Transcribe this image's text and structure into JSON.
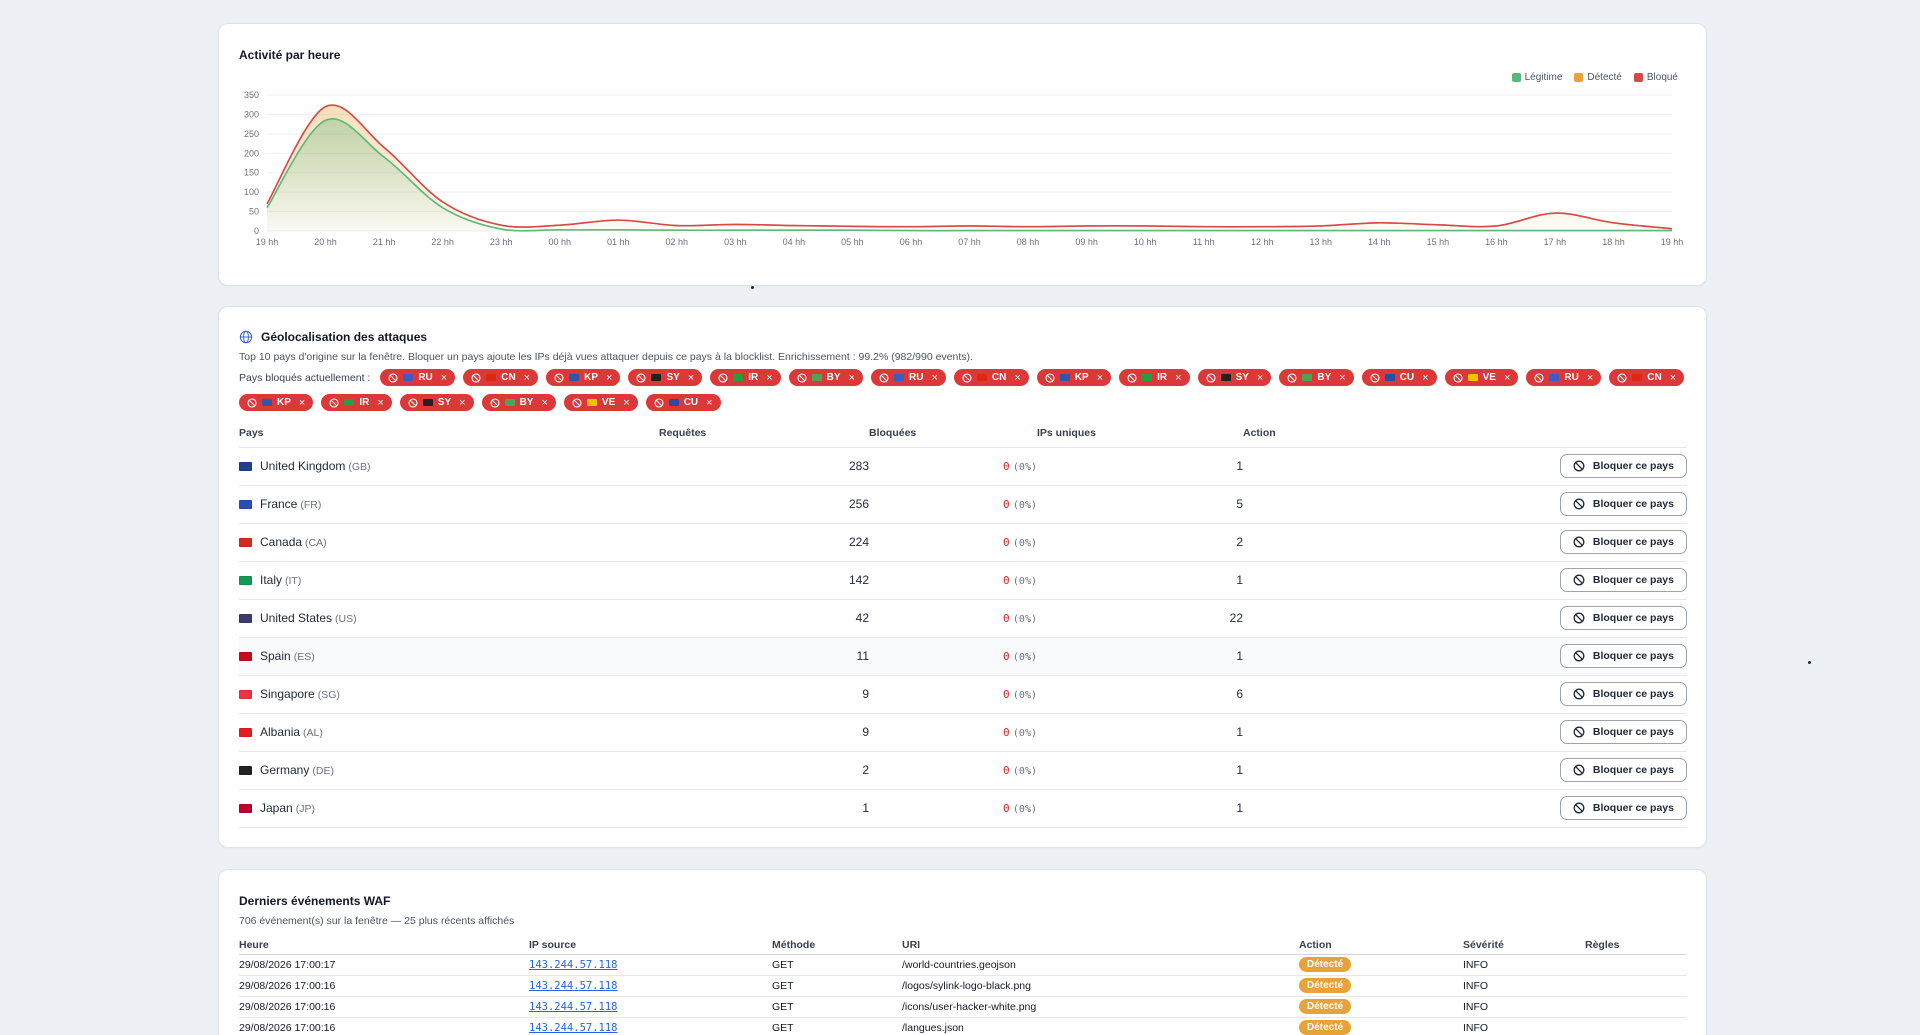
{
  "chart_card": {
    "title": "Activité par heure",
    "legend": [
      {
        "label": "Légitime",
        "color": "#5cb87a"
      },
      {
        "label": "Détecté",
        "color": "#e8a23a"
      },
      {
        "label": "Bloqué",
        "color": "#d94848"
      }
    ]
  },
  "chart_data": {
    "type": "area",
    "title": "Activité par heure",
    "categories": [
      "19 hh",
      "20 hh",
      "21 hh",
      "22 hh",
      "23 hh",
      "00 hh",
      "01 hh",
      "02 hh",
      "03 hh",
      "04 hh",
      "05 hh",
      "06 hh",
      "07 hh",
      "08 hh",
      "09 hh",
      "10 hh",
      "11 hh",
      "12 hh",
      "13 hh",
      "14 hh",
      "15 hh",
      "16 hh",
      "17 hh",
      "18 hh",
      "19 hh"
    ],
    "ylim": [
      0,
      350
    ],
    "yticks": [
      0,
      50,
      100,
      150,
      200,
      250,
      300,
      350
    ],
    "grid": true,
    "legend_position": "top-right",
    "series": [
      {
        "name": "Légitime",
        "values": [
          60,
          285,
          190,
          60,
          5,
          3,
          3,
          2,
          2,
          2,
          2,
          1,
          1,
          1,
          1,
          1,
          1,
          1,
          1,
          1,
          1,
          1,
          1,
          1,
          1
        ]
      },
      {
        "name": "Détecté",
        "values": [
          10,
          35,
          25,
          15,
          10,
          12,
          25,
          12,
          15,
          12,
          10,
          10,
          12,
          10,
          12,
          12,
          10,
          10,
          12,
          20,
          15,
          12,
          45,
          20,
          5
        ]
      },
      {
        "name": "Bloqué",
        "values": [
          0,
          0,
          0,
          0,
          0,
          0,
          0,
          0,
          0,
          0,
          0,
          0,
          0,
          0,
          0,
          0,
          0,
          0,
          0,
          0,
          0,
          0,
          0,
          0,
          0
        ]
      }
    ]
  },
  "geo": {
    "title": "Géolocalisation des attaques",
    "description": "Top 10 pays d'origine sur la fenêtre. Bloquer un pays ajoute les IPs déjà vues attaquer depuis ce pays à la blocklist. Enrichissement : 99.2% (982/990 events).",
    "blocked_label": "Pays bloqués actuellement :",
    "blocked_chips": [
      {
        "code": "RU",
        "flag": "#3b5fc0"
      },
      {
        "code": "CN",
        "flag": "#de2910"
      },
      {
        "code": "KP",
        "flag": "#3056a8"
      },
      {
        "code": "SY",
        "flag": "#222222"
      },
      {
        "code": "IR",
        "flag": "#239f40"
      },
      {
        "code": "BY",
        "flag": "#4aa657"
      },
      {
        "code": "RU",
        "flag": "#3b5fc0"
      },
      {
        "code": "CN",
        "flag": "#de2910"
      },
      {
        "code": "KP",
        "flag": "#3056a8"
      },
      {
        "code": "IR",
        "flag": "#239f40"
      },
      {
        "code": "SY",
        "flag": "#222222"
      },
      {
        "code": "BY",
        "flag": "#4aa657"
      },
      {
        "code": "CU",
        "flag": "#2a4da0"
      },
      {
        "code": "VE",
        "flag": "#f2c200"
      },
      {
        "code": "RU",
        "flag": "#3b5fc0"
      },
      {
        "code": "CN",
        "flag": "#de2910"
      },
      {
        "code": "KP",
        "flag": "#3056a8"
      },
      {
        "code": "IR",
        "flag": "#239f40"
      },
      {
        "code": "SY",
        "flag": "#222222"
      },
      {
        "code": "BY",
        "flag": "#4aa657"
      },
      {
        "code": "VE",
        "flag": "#f2c200"
      },
      {
        "code": "CU",
        "flag": "#2a4da0"
      }
    ],
    "headers": {
      "country": "Pays",
      "requests": "Requêtes",
      "blocked": "Bloquées",
      "unique_ips": "IPs uniques",
      "action": "Action"
    },
    "button_label": "Bloquer ce pays",
    "rows": [
      {
        "name": "United Kingdom",
        "code": "(GB)",
        "requests": "283",
        "blocked": "0",
        "pct": "(0%)",
        "ips": "1",
        "flag": "#1f3f8f"
      },
      {
        "name": "France",
        "code": "(FR)",
        "requests": "256",
        "blocked": "0",
        "pct": "(0%)",
        "ips": "5",
        "flag": "#2b4fb0"
      },
      {
        "name": "Canada",
        "code": "(CA)",
        "requests": "224",
        "blocked": "0",
        "pct": "(0%)",
        "ips": "2",
        "flag": "#d52b1e"
      },
      {
        "name": "Italy",
        "code": "(IT)",
        "requests": "142",
        "blocked": "0",
        "pct": "(0%)",
        "ips": "1",
        "flag": "#149954"
      },
      {
        "name": "United States",
        "code": "(US)",
        "requests": "42",
        "blocked": "0",
        "pct": "(0%)",
        "ips": "22",
        "flag": "#3c3b6e"
      },
      {
        "name": "Spain",
        "code": "(ES)",
        "requests": "11",
        "blocked": "0",
        "pct": "(0%)",
        "ips": "1",
        "flag": "#c60b1e"
      },
      {
        "name": "Singapore",
        "code": "(SG)",
        "requests": "9",
        "blocked": "0",
        "pct": "(0%)",
        "ips": "6",
        "flag": "#ef3340"
      },
      {
        "name": "Albania",
        "code": "(AL)",
        "requests": "9",
        "blocked": "0",
        "pct": "(0%)",
        "ips": "1",
        "flag": "#e41e20"
      },
      {
        "name": "Germany",
        "code": "(DE)",
        "requests": "2",
        "blocked": "0",
        "pct": "(0%)",
        "ips": "1",
        "flag": "#222222"
      },
      {
        "name": "Japan",
        "code": "(JP)",
        "requests": "1",
        "blocked": "0",
        "pct": "(0%)",
        "ips": "1",
        "flag": "#bc002d"
      }
    ]
  },
  "events": {
    "title": "Derniers événements WAF",
    "description": "706 événement(s) sur la fenêtre — 25 plus récents affichés",
    "headers": {
      "time": "Heure",
      "ip": "IP source",
      "method": "Méthode",
      "uri": "URI",
      "action": "Action",
      "severity": "Sévérité",
      "rules": "Règles"
    },
    "rows": [
      {
        "time": "29/08/2026 17:00:17",
        "ip": "143.244.57.118",
        "method": "GET",
        "uri": "/world-countries.geojson",
        "action": "Détecté",
        "severity": "INFO",
        "rules": ""
      },
      {
        "time": "29/08/2026 17:00:16",
        "ip": "143.244.57.118",
        "method": "GET",
        "uri": "/logos/sylink-logo-black.png",
        "action": "Détecté",
        "severity": "INFO",
        "rules": ""
      },
      {
        "time": "29/08/2026 17:00:16",
        "ip": "143.244.57.118",
        "method": "GET",
        "uri": "/icons/user-hacker-white.png",
        "action": "Détecté",
        "severity": "INFO",
        "rules": ""
      },
      {
        "time": "29/08/2026 17:00:16",
        "ip": "143.244.57.118",
        "method": "GET",
        "uri": "/langues.json",
        "action": "Détecté",
        "severity": "INFO",
        "rules": ""
      }
    ]
  }
}
